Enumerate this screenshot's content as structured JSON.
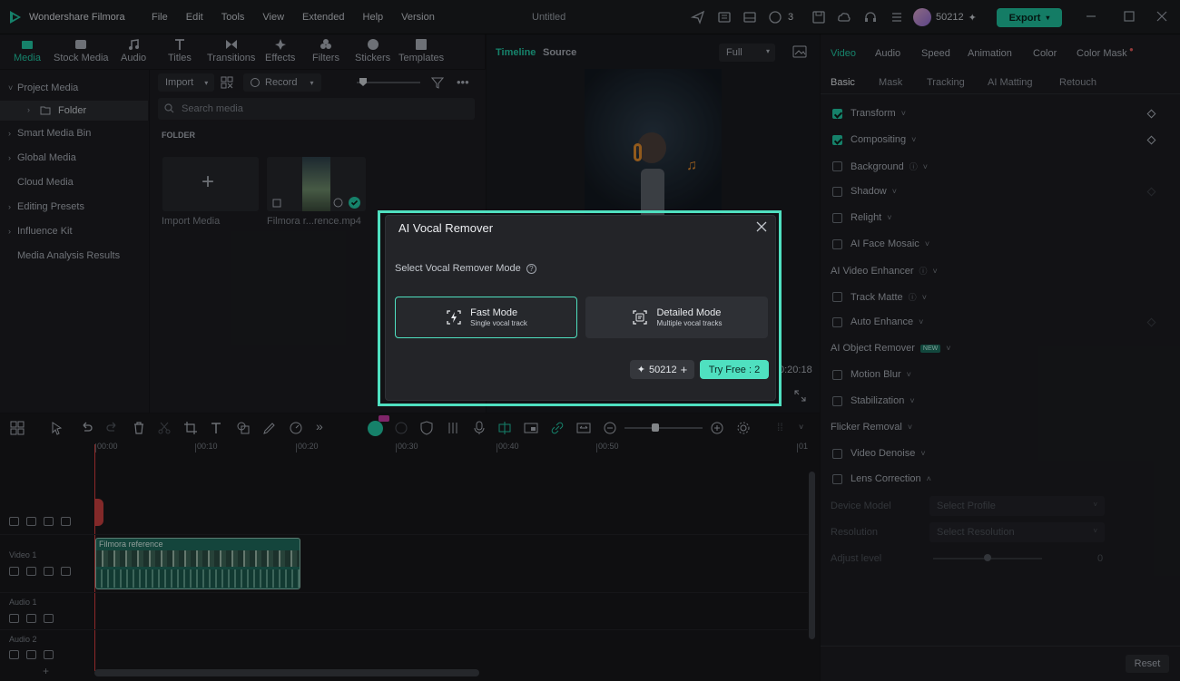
{
  "app": {
    "name": "Wondershare Filmora",
    "doc_title": "Untitled"
  },
  "menu": [
    "File",
    "Edit",
    "Tools",
    "View",
    "Extended",
    "Help",
    "Version"
  ],
  "titlebar": {
    "badge_count": "3",
    "credits": "50212",
    "export_label": "Export"
  },
  "left_tabs": [
    "Media",
    "Stock Media",
    "Audio",
    "Titles",
    "Transitions",
    "Effects",
    "Filters",
    "Stickers",
    "Templates"
  ],
  "sidebar": {
    "project_media": "Project Media",
    "folder": "Folder",
    "items": [
      "Smart Media Bin",
      "Global Media",
      "Cloud Media",
      "Editing Presets",
      "Influence Kit",
      "Media Analysis Results"
    ]
  },
  "media": {
    "import_label": "Import",
    "record_label": "Record",
    "search_placeholder": "Search media",
    "folder_header": "FOLDER",
    "import_media": "Import Media",
    "clip_name": "Filmora r...rence.mp4"
  },
  "preview": {
    "tab_timeline": "Timeline",
    "tab_source": "Source",
    "quality": "Full",
    "time": "0:20:18"
  },
  "inspector": {
    "tabs": [
      "Video",
      "Audio",
      "Speed",
      "Animation",
      "Color",
      "Color Mask"
    ],
    "subtabs": [
      "Basic",
      "Mask",
      "Tracking",
      "AI Matting",
      "Retouch"
    ],
    "props": {
      "transform": "Transform",
      "compositing": "Compositing",
      "background": "Background",
      "shadow": "Shadow",
      "relight": "Relight",
      "ai_face_mosaic": "AI Face Mosaic",
      "ai_video_enhancer": "AI Video Enhancer",
      "track_matte": "Track Matte",
      "auto_enhance": "Auto Enhance",
      "ai_object_remover": "AI Object Remover",
      "new_badge": "NEW",
      "motion_blur": "Motion Blur",
      "stabilization": "Stabilization",
      "flicker_removal": "Flicker Removal",
      "video_denoise": "Video Denoise",
      "lens_correction": "Lens Correction",
      "device_model": "Device Model",
      "device_select": "Select Profile",
      "resolution": "Resolution",
      "resolution_select": "Select Resolution",
      "adjust_level": "Adjust level",
      "adjust_value": "0"
    },
    "reset_label": "Reset"
  },
  "timeline": {
    "ticks": [
      "00:00",
      "00:10",
      "00:20",
      "00:30",
      "00:40",
      "00:50",
      "01"
    ],
    "tracks": {
      "video1": "Video 1",
      "audio1": "Audio 1",
      "audio2": "Audio 2"
    },
    "clip_label": "Filmora reference"
  },
  "dialog": {
    "title": "AI Vocal Remover",
    "mode_label": "Select Vocal Remover Mode",
    "fast_title": "Fast Mode",
    "fast_sub": "Single vocal track",
    "detailed_title": "Detailed Mode",
    "detailed_sub": "Multiple vocal tracks",
    "credits": "50212",
    "try_free": "Try Free : 2"
  },
  "colors": {
    "accent": "#22c7a3",
    "highlight": "#4fe0c0",
    "playhead": "#d94040"
  }
}
